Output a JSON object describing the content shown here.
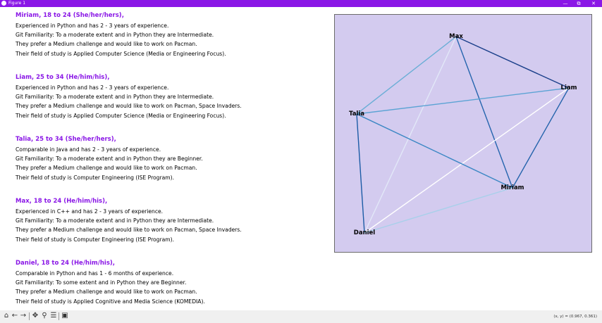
{
  "window": {
    "title": "Figure 1",
    "minimize_icon": "—",
    "maximize_icon": "⧉",
    "close_icon": "✕"
  },
  "profiles": [
    {
      "name": "Miriam, 18 to 24 (She/her/hers),",
      "lines": [
        "Experienced in Python and has 2 - 3 years of experience.",
        "Git Familiarity: To a moderate extent and in Python they are Intermediate.",
        "They prefer a Medium challenge and would like to work on Pacman.",
        "Their field of study is Applied Computer Science (Media or Engineering Focus)."
      ]
    },
    {
      "name": "Liam, 25 to 34 (He/him/his),",
      "lines": [
        "Experienced in Python and has 2 - 3 years of experience.",
        "Git Familiarity: To a moderate extent and in Python they are Intermediate.",
        "They prefer a Medium challenge and would like to work on Pacman, Space Invaders.",
        "Their field of study is Applied Computer Science (Media or Engineering Focus)."
      ]
    },
    {
      "name": "Talia, 25 to 34 (She/her/hers),",
      "lines": [
        "Comparable in Java and has 2 - 3 years of experience.",
        "Git Familiarity: To a moderate extent and in Python they are Beginner.",
        "They prefer a Medium challenge and would like to work on Pacman.",
        "Their field of study is Computer Engineering (ISE Program)."
      ]
    },
    {
      "name": "Max, 18 to 24 (He/him/his),",
      "lines": [
        "Experienced in C++ and has 2 - 3 years of experience.",
        "Git Familiarity: To a moderate extent and in Python they are Intermediate.",
        "They prefer a Medium challenge and would like to work on Pacman, Space Invaders.",
        "Their field of study is Computer Engineering (ISE Program)."
      ]
    },
    {
      "name": "Daniel, 18 to 24 (He/him/his),",
      "lines": [
        "Comparable in Python and has 1 - 6 months of experience.",
        "Git Familiarity: To some extent and in Python they are Beginner.",
        "They prefer a Medium challenge and would like to work on Pacman.",
        "Their field of study is Applied Cognitive and Media Science (KOMEDIA)."
      ]
    }
  ],
  "graph": {
    "background": "#d3cbef",
    "nodes": [
      "Max",
      "Liam",
      "Talia",
      "Miriam",
      "Daniel"
    ],
    "edges": [
      {
        "from": "Max",
        "to": "Liam",
        "color": "#1a3f8a"
      },
      {
        "from": "Max",
        "to": "Talia",
        "color": "#6aaed6"
      },
      {
        "from": "Max",
        "to": "Miriam",
        "color": "#2565ae"
      },
      {
        "from": "Max",
        "to": "Daniel",
        "color": "#e2e8f8"
      },
      {
        "from": "Liam",
        "to": "Talia",
        "color": "#5ba3d4"
      },
      {
        "from": "Liam",
        "to": "Miriam",
        "color": "#2363ab"
      },
      {
        "from": "Liam",
        "to": "Daniel",
        "color": "#ffffff"
      },
      {
        "from": "Talia",
        "to": "Miriam",
        "color": "#3b87c4"
      },
      {
        "from": "Talia",
        "to": "Daniel",
        "color": "#1c5ca6"
      },
      {
        "from": "Miriam",
        "to": "Daniel",
        "color": "#a8d0ea"
      }
    ]
  },
  "toolbar": {
    "home_icon": "home-icon",
    "back_icon": "back-arrow-icon",
    "forward_icon": "forward-arrow-icon",
    "pan_icon": "pan-icon",
    "zoom_icon": "zoom-icon",
    "configure_icon": "configure-subplots-icon",
    "save_icon": "save-icon",
    "coords": "(x, y) = (0.967, 0.361)"
  }
}
